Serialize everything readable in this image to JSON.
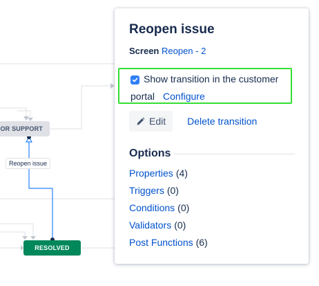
{
  "canvas": {
    "statuses": [
      {
        "id": "waiting",
        "label": "OR SUPPORT",
        "color": "#dfe1e6"
      },
      {
        "id": "resolved",
        "label": "RESOLVED",
        "color": "#00875a"
      }
    ],
    "transition_label": "Reopen issue"
  },
  "panel": {
    "title": "Reopen issue",
    "screen_label": "Screen",
    "screen_value": "Reopen - 2",
    "portal_checkbox": {
      "checked": true,
      "label": "Show transition in the customer portal",
      "configure_link": "Configure"
    },
    "edit_button": "Edit",
    "delete_link": "Delete transition",
    "options": {
      "heading": "Options",
      "items": [
        {
          "label": "Properties",
          "count": "(4)"
        },
        {
          "label": "Triggers",
          "count": "(0)"
        },
        {
          "label": "Conditions",
          "count": "(0)"
        },
        {
          "label": "Validators",
          "count": "(0)"
        },
        {
          "label": "Post Functions",
          "count": "(6)"
        }
      ]
    }
  },
  "colors": {
    "link": "#0052cc",
    "text": "#172b4d",
    "resolved_green": "#00875a",
    "highlight_green": "#33dd33",
    "checkbox_blue": "#2f7ff5",
    "transition_line": "#2684ff"
  },
  "icons": {
    "edit": "pencil-icon",
    "checkbox": "checkmark-icon"
  }
}
